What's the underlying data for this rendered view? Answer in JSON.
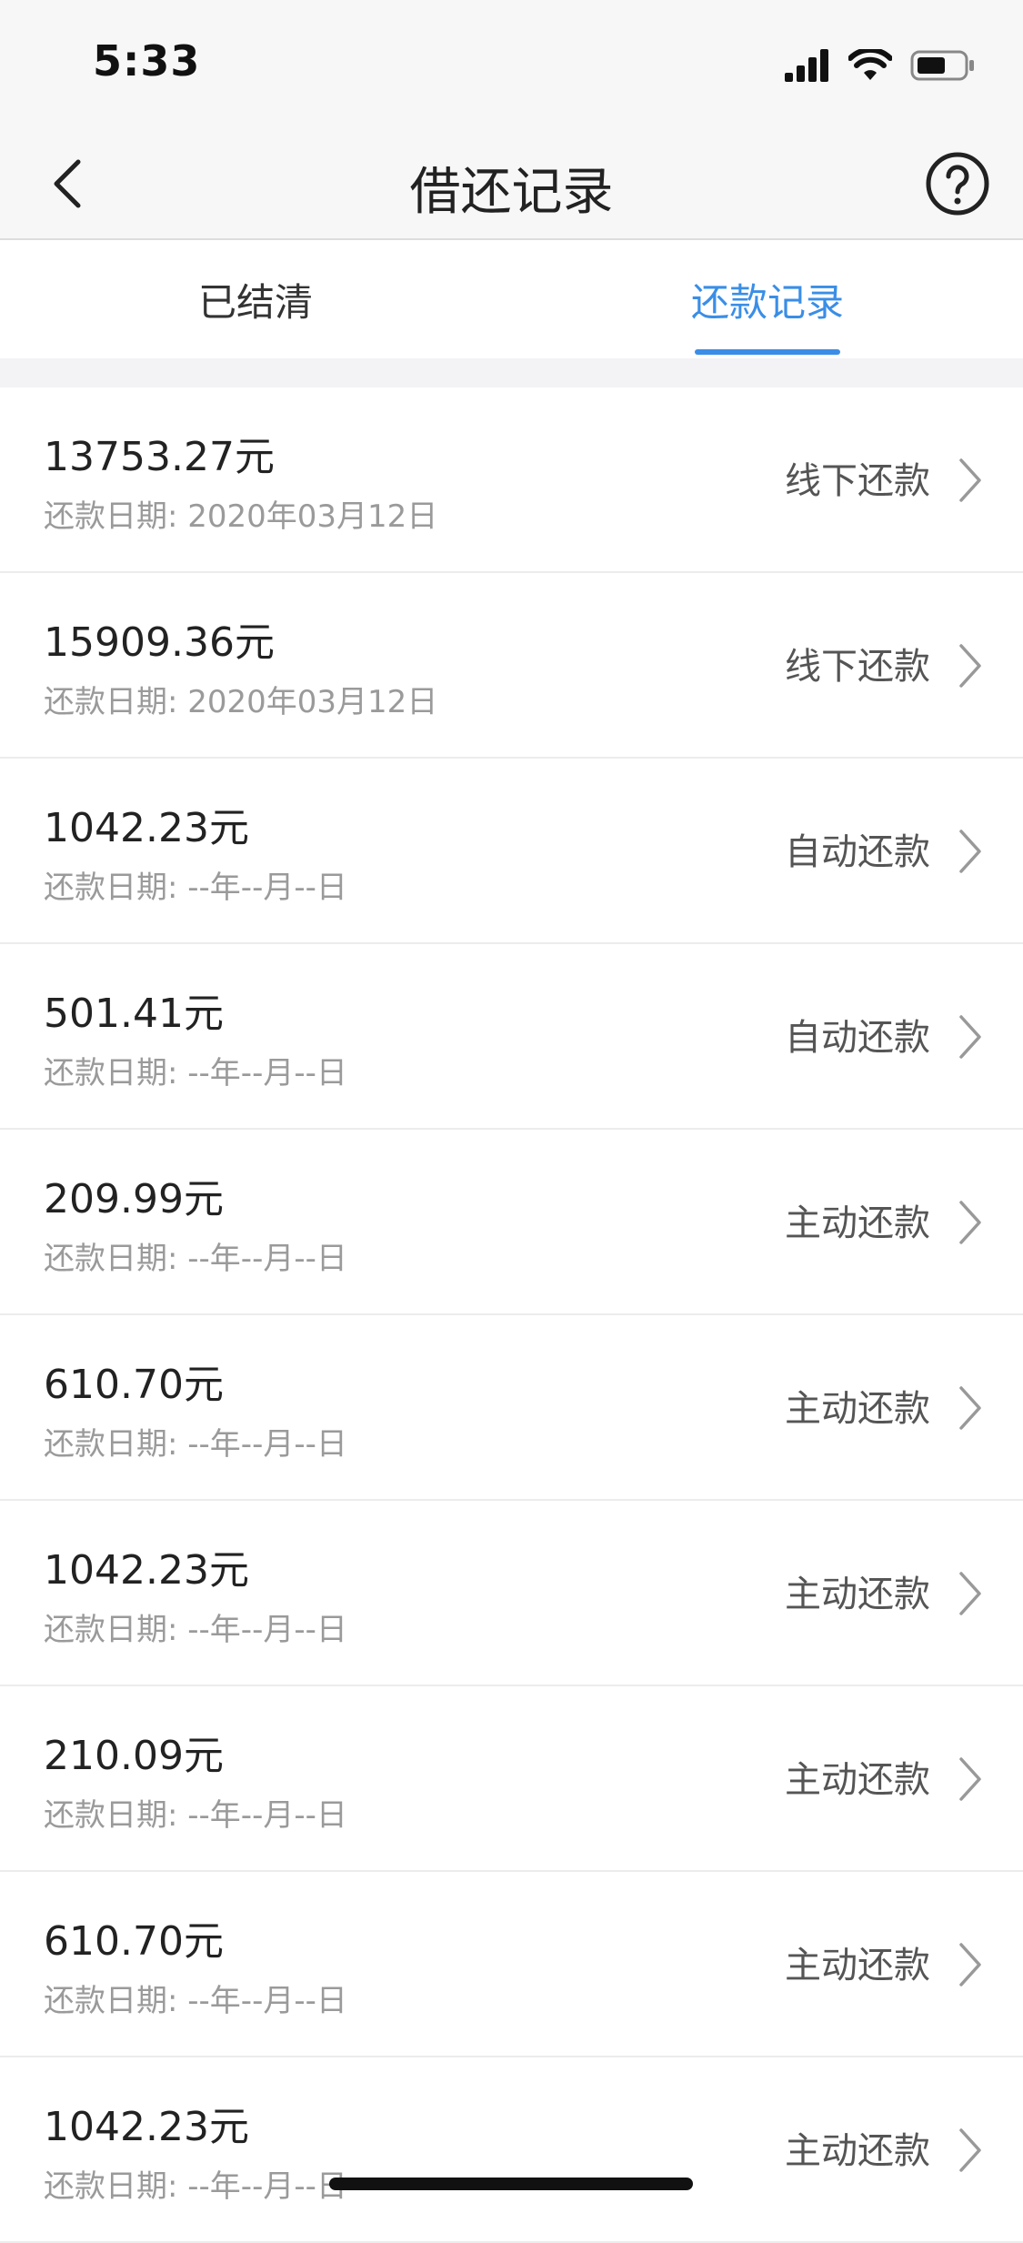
{
  "status_bar": {
    "time": "5:33",
    "icons": [
      "signal-icon",
      "wifi-icon",
      "battery-icon"
    ]
  },
  "nav": {
    "title": "借还记录",
    "back_icon": "chevron-left-icon",
    "help_icon": "question-circle-icon"
  },
  "tabs": [
    {
      "label": "已结清",
      "active": false
    },
    {
      "label": "还款记录",
      "active": true
    }
  ],
  "colors": {
    "accent": "#3a8ee6",
    "text_primary": "#222222",
    "text_secondary": "#9a9a9a",
    "divider": "#ececec"
  },
  "records": [
    {
      "amount": "13753.27元",
      "date": "还款日期: 2020年03月12日",
      "type": "线下还款"
    },
    {
      "amount": "15909.36元",
      "date": "还款日期: 2020年03月12日",
      "type": "线下还款"
    },
    {
      "amount": "1042.23元",
      "date": "还款日期: --年--月--日",
      "type": "自动还款"
    },
    {
      "amount": "501.41元",
      "date": "还款日期: --年--月--日",
      "type": "自动还款"
    },
    {
      "amount": "209.99元",
      "date": "还款日期: --年--月--日",
      "type": "主动还款"
    },
    {
      "amount": "610.70元",
      "date": "还款日期: --年--月--日",
      "type": "主动还款"
    },
    {
      "amount": "1042.23元",
      "date": "还款日期: --年--月--日",
      "type": "主动还款"
    },
    {
      "amount": "210.09元",
      "date": "还款日期: --年--月--日",
      "type": "主动还款"
    },
    {
      "amount": "610.70元",
      "date": "还款日期: --年--月--日",
      "type": "主动还款"
    },
    {
      "amount": "1042.23元",
      "date": "还款日期: --年--月--日",
      "type": "主动还款"
    }
  ]
}
